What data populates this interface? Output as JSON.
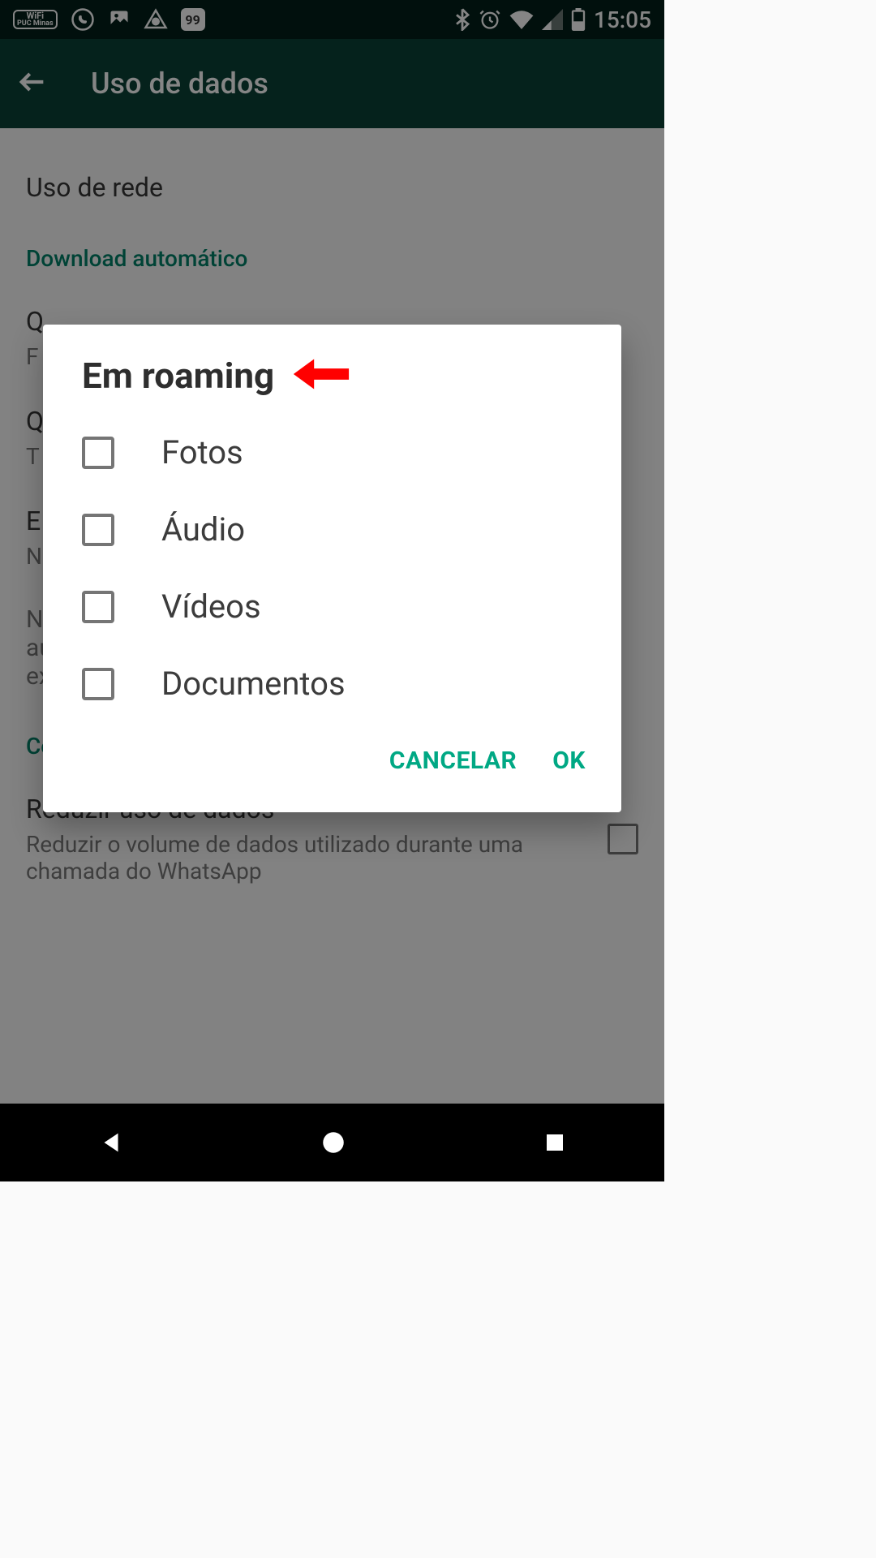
{
  "statusbar": {
    "wifi_label_top": "WiFi",
    "wifi_label_bottom": "PUC Minas",
    "notification_count": "99",
    "time": "15:05"
  },
  "appbar": {
    "title": "Uso de dados"
  },
  "settings": {
    "network_usage": "Uso de rede",
    "auto_download_header": "Download automático",
    "mobile_data_title": "Q",
    "mobile_data_sub": "F",
    "wifi_title": "Q",
    "wifi_sub": "T",
    "roaming_title": "E",
    "roaming_sub": "N",
    "note": "N\nau\nex",
    "calls_header": "Config de Chamadas",
    "reduce_data_title": "Reduzir uso de dados",
    "reduce_data_sub": "Reduzir o volume de dados utilizado durante uma chamada do WhatsApp"
  },
  "dialog": {
    "title": "Em roaming",
    "options": [
      {
        "label": "Fotos",
        "checked": false
      },
      {
        "label": "Áudio",
        "checked": false
      },
      {
        "label": "Vídeos",
        "checked": false
      },
      {
        "label": "Documentos",
        "checked": false
      }
    ],
    "cancel_label": "CANCELAR",
    "ok_label": "OK"
  }
}
